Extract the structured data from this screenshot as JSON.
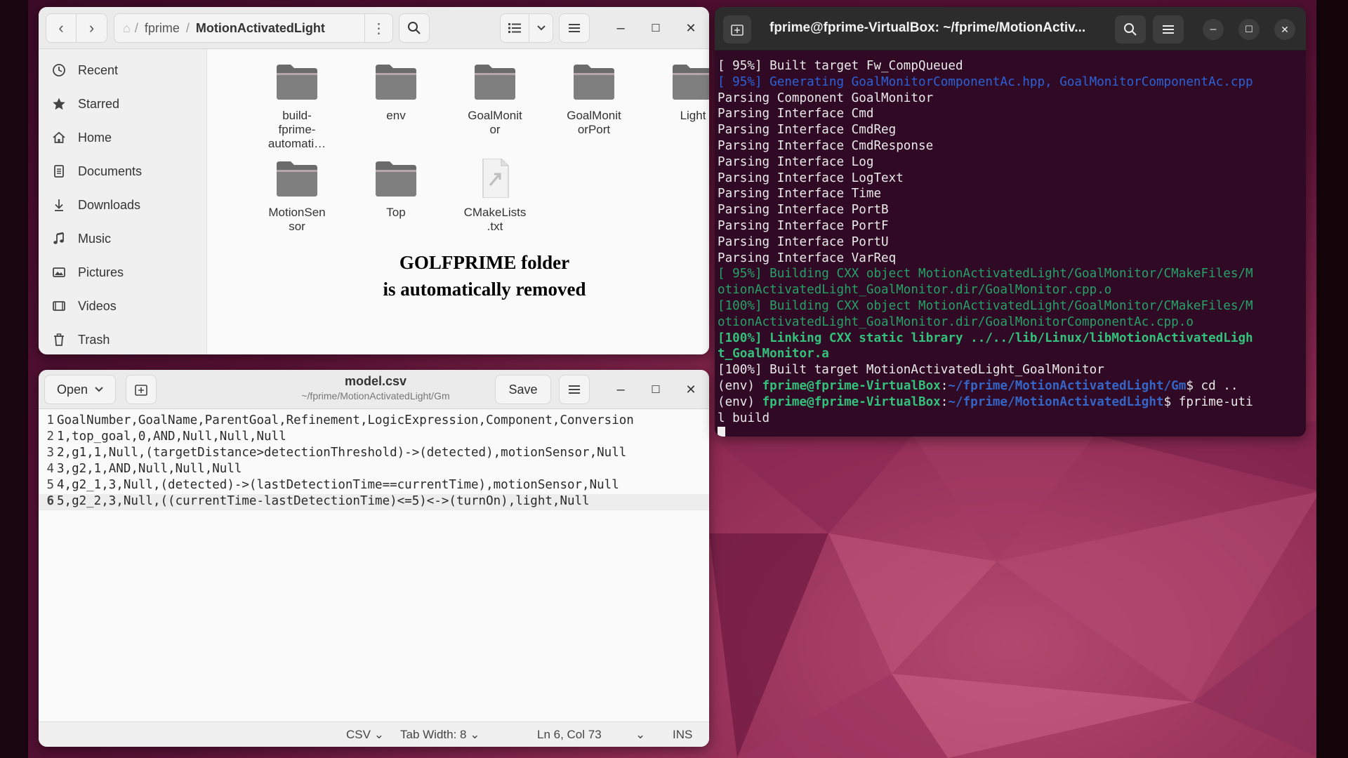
{
  "files": {
    "path_home": "⌂",
    "path_parent": "fprime",
    "path_current": "MotionActivatedLight",
    "sidebar": [
      {
        "label": "Recent",
        "icon": "clock-icon"
      },
      {
        "label": "Starred",
        "icon": "star-icon"
      },
      {
        "label": "Home",
        "icon": "home-icon"
      },
      {
        "label": "Documents",
        "icon": "document-icon"
      },
      {
        "label": "Downloads",
        "icon": "download-icon"
      },
      {
        "label": "Music",
        "icon": "music-icon"
      },
      {
        "label": "Pictures",
        "icon": "picture-icon"
      },
      {
        "label": "Videos",
        "icon": "video-icon"
      },
      {
        "label": "Trash",
        "icon": "trash-icon"
      }
    ],
    "items": [
      {
        "l1": "build-",
        "l2": "fprime-",
        "l3": "automati…",
        "type": "folder"
      },
      {
        "l1": "env",
        "l2": "",
        "l3": "",
        "type": "folder"
      },
      {
        "l1": "GoalMonit",
        "l2": "or",
        "l3": "",
        "type": "folder"
      },
      {
        "l1": "GoalMonit",
        "l2": "orPort",
        "l3": "",
        "type": "folder"
      },
      {
        "l1": "Light",
        "l2": "",
        "l3": "",
        "type": "folder"
      },
      {
        "l1": "MotionSen",
        "l2": "sor",
        "l3": "",
        "type": "folder"
      },
      {
        "l1": "Top",
        "l2": "",
        "l3": "",
        "type": "folder"
      },
      {
        "l1": "CMakeLists",
        "l2": ".txt",
        "l3": "",
        "type": "file"
      }
    ],
    "caption_line1": "GOLFPRIME folder",
    "caption_line2": "is automatically removed"
  },
  "editor": {
    "open_label": "Open",
    "save_label": "Save",
    "filename": "model.csv",
    "filepath": "~/fprime/MotionActivatedLight/Gm",
    "lines": [
      "GoalNumber,GoalName,ParentGoal,Refinement,LogicExpression,Component,Conversion",
      "1,top_goal,0,AND,Null,Null,Null",
      "2,g1,1,Null,(targetDistance>detectionThreshold)->(detected),motionSensor,Null",
      "3,g2,1,AND,Null,Null,Null",
      "4,g2_1,3,Null,(detected)->(lastDetectionTime==currentTime),motionSensor,Null",
      "5,g2_2,3,Null,((currentTime-lastDetectionTime)<=5)<->(turnOn),light,Null"
    ],
    "status_lang": "CSV",
    "status_tab": "Tab Width: 8",
    "status_pos": "Ln 6, Col 73",
    "status_mode": "INS"
  },
  "terminal": {
    "title": "fprime@fprime-VirtualBox: ~/fprime/MotionActiv...",
    "lines": [
      "[ 95%] Built target Fw_CompQueued",
      "[ 95%] Generating GoalMonitorComponentAc.hpp, GoalMonitorComponentAc.cpp",
      "Parsing Component GoalMonitor",
      "Parsing Interface Cmd",
      "Parsing Interface CmdReg",
      "Parsing Interface CmdResponse",
      "Parsing Interface Log",
      "Parsing Interface LogText",
      "Parsing Interface Time",
      "Parsing Interface PortB",
      "Parsing Interface PortF",
      "Parsing Interface PortU",
      "Parsing Interface VarReq",
      "[ 95%] Building CXX object MotionActivatedLight/GoalMonitor/CMakeFiles/M",
      "otionActivatedLight_GoalMonitor.dir/GoalMonitor.cpp.o",
      "[100%] Building CXX object MotionActivatedLight/GoalMonitor/CMakeFiles/M",
      "otionActivatedLight_GoalMonitor.dir/GoalMonitorComponentAc.cpp.o",
      "[100%] Linking CXX static library ../../lib/Linux/libMotionActivatedLigh",
      "t_GoalMonitor.a",
      "[100%] Built target MotionActivatedLight_GoalMonitor"
    ],
    "prompt1_env": "(env) ",
    "prompt1_user": "fprime@fprime-VirtualBox",
    "prompt1_path": "~/fprime/MotionActivatedLight/Gm",
    "prompt1_cmd": "$ cd ..",
    "prompt2_env": "(env) ",
    "prompt2_user": "fprime@fprime-VirtualBox",
    "prompt2_path": "~/fprime/MotionActivatedLight",
    "prompt2_cmd": "$ fprime-uti",
    "prompt2_cmd_wrap": "l build",
    "colors": {
      "background": "#300a24",
      "green": "#26a269",
      "blue": "#2b62d8"
    }
  }
}
